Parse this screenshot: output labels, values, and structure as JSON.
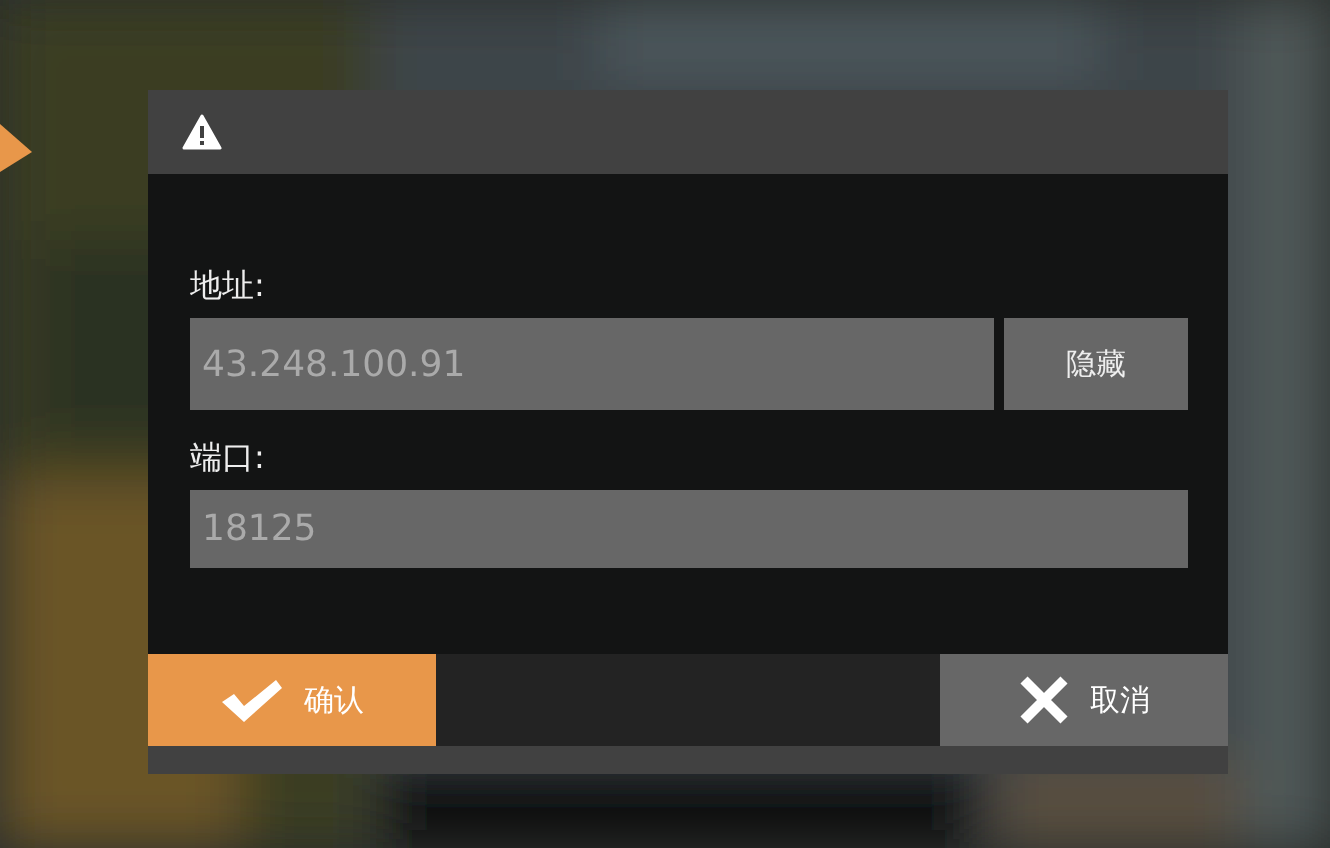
{
  "dialog": {
    "address": {
      "label": "地址:",
      "value": "43.248.100.91"
    },
    "hide_button": "隐藏",
    "port": {
      "label": "端口:",
      "value": "18125"
    },
    "buttons": [
      {
        "label": "确认",
        "kind": "confirm"
      },
      {
        "label": "取消",
        "kind": "cancel"
      }
    ]
  }
}
